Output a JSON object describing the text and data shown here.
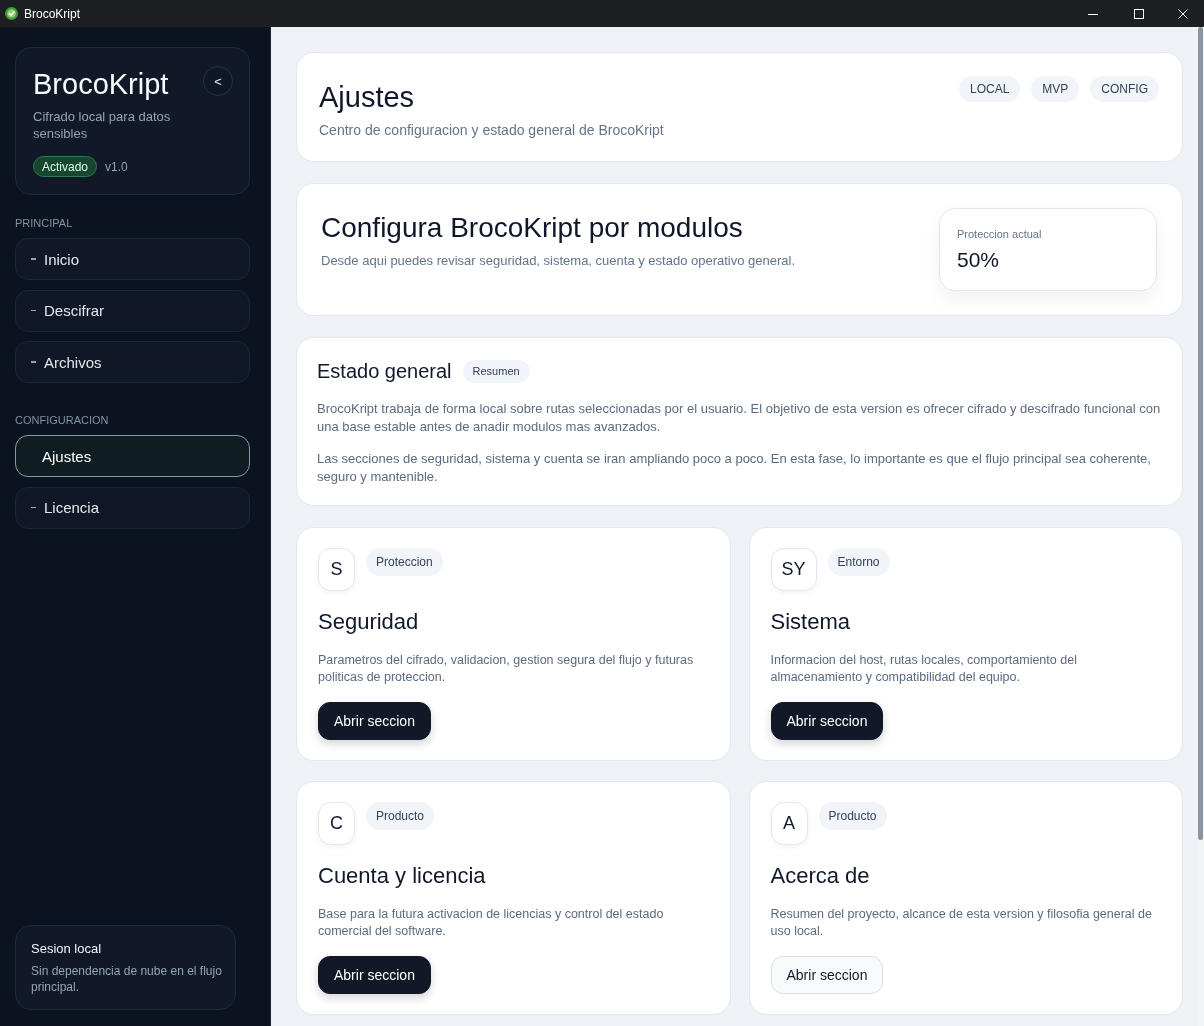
{
  "window": {
    "title": "BrocoKript"
  },
  "sidebar": {
    "brand": {
      "title": "BrocoKript",
      "collapse_button": "<",
      "subtitle": "Cifrado local para datos sensibles",
      "status": "Activado",
      "version": "v1.0"
    },
    "sections": [
      {
        "label": "PRINCIPAL",
        "items": [
          {
            "label": "Inicio",
            "selected": false
          },
          {
            "label": "Descifrar",
            "selected": false
          },
          {
            "label": "Archivos",
            "selected": false
          }
        ]
      },
      {
        "label": "CONFIGURACION",
        "items": [
          {
            "label": "Ajustes",
            "selected": true
          },
          {
            "label": "Licencia",
            "selected": false
          }
        ]
      }
    ],
    "footer": {
      "title": "Sesion local",
      "text": "Sin dependencia de nube en el flujo principal."
    }
  },
  "header": {
    "title": "Ajustes",
    "subtitle": "Centro de configuracion y estado general de BrocoKript",
    "tags": [
      "LOCAL",
      "MVP",
      "CONFIG"
    ]
  },
  "hero": {
    "title": "Configura BrocoKript por modulos",
    "text": "Desde aqui puedes revisar seguridad, sistema, cuenta y estado operativo general.",
    "stat": {
      "label": "Proteccion actual",
      "value": "50%"
    }
  },
  "overview": {
    "title": "Estado general",
    "tag": "Resumen",
    "paragraphs": [
      "BrocoKript trabaja de forma local sobre rutas seleccionadas por el usuario. El objetivo de esta version es ofrecer cifrado y descifrado funcional con una base estable antes de anadir modulos mas avanzados.",
      "Las secciones de seguridad, sistema y cuenta se iran ampliando poco a poco. En esta fase, lo importante es que el flujo principal sea coherente, seguro y mantenible."
    ]
  },
  "modules": [
    {
      "monogram": "S",
      "tag": "Proteccion",
      "title": "Seguridad",
      "text": "Parametros del cifrado, validacion, gestion segura del flujo y futuras politicas de proteccion.",
      "button": {
        "label": "Abrir seccion",
        "kind": "primary"
      }
    },
    {
      "monogram": "SY",
      "tag": "Entorno",
      "title": "Sistema",
      "text": "Informacion del host, rutas locales, comportamiento del almacenamiento y compatibilidad del equipo.",
      "button": {
        "label": "Abrir seccion",
        "kind": "primary"
      }
    },
    {
      "monogram": "C",
      "tag": "Producto",
      "title": "Cuenta y licencia",
      "text": "Base para la futura activacion de licencias y control del estado comercial del software.",
      "button": {
        "label": "Abrir seccion",
        "kind": "primary"
      }
    },
    {
      "monogram": "A",
      "tag": "Producto",
      "title": "Acerca de",
      "text": "Resumen del proyecto, alcance de esta version y filosofia general de uso local.",
      "button": {
        "label": "Abrir seccion",
        "kind": "secondary"
      }
    }
  ]
}
